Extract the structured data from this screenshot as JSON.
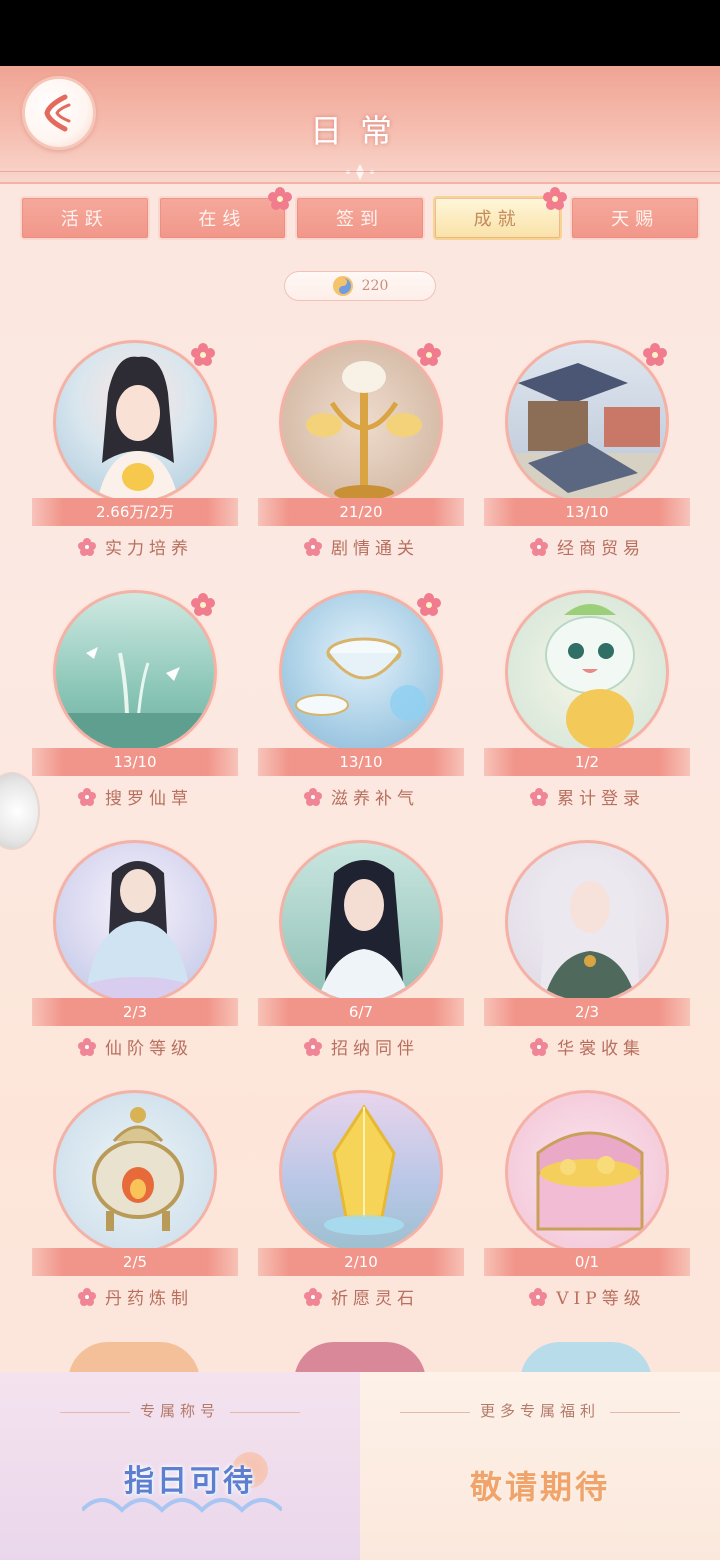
{
  "header": {
    "title": "日常"
  },
  "tabs": [
    {
      "label": "活跃",
      "badge": false,
      "active": false
    },
    {
      "label": "在线",
      "badge": true,
      "active": false
    },
    {
      "label": "签到",
      "badge": false,
      "active": false
    },
    {
      "label": "成就",
      "badge": true,
      "active": true
    },
    {
      "label": "天赐",
      "badge": false,
      "active": false
    }
  ],
  "currency": {
    "amount": "220",
    "icon": "spirit-coin-icon"
  },
  "achievements": [
    {
      "progress": "2.66万/2万",
      "label": "实力培养",
      "badge": true,
      "theme": "portrait-maiden"
    },
    {
      "progress": "21/20",
      "label": "剧情通关",
      "badge": true,
      "theme": "golden-lotus"
    },
    {
      "progress": "13/10",
      "label": "经商贸易",
      "badge": true,
      "theme": "market-street"
    },
    {
      "progress": "13/10",
      "label": "搜罗仙草",
      "badge": true,
      "theme": "spirit-grass"
    },
    {
      "progress": "13/10",
      "label": "滋养补气",
      "badge": true,
      "theme": "tea-bowls"
    },
    {
      "progress": "1/2",
      "label": "累计登录",
      "badge": false,
      "theme": "spirit-pet"
    },
    {
      "progress": "2/3",
      "label": "仙阶等级",
      "badge": false,
      "theme": "meditating-immortal"
    },
    {
      "progress": "6/7",
      "label": "招纳同伴",
      "badge": false,
      "theme": "companion-swordsman"
    },
    {
      "progress": "2/3",
      "label": "华裳收集",
      "badge": false,
      "theme": "white-hair-lady"
    },
    {
      "progress": "2/5",
      "label": "丹药炼制",
      "badge": false,
      "theme": "alchemy-cauldron"
    },
    {
      "progress": "2/10",
      "label": "祈愿灵石",
      "badge": false,
      "theme": "wish-crystal"
    },
    {
      "progress": "0/1",
      "label": "VIP等级",
      "badge": false,
      "theme": "treasure-chest"
    }
  ],
  "bottom": {
    "left_title": "专属称号",
    "left_text": "指日可待",
    "right_title": "更多专属福利",
    "right_text": "敬请期待"
  }
}
